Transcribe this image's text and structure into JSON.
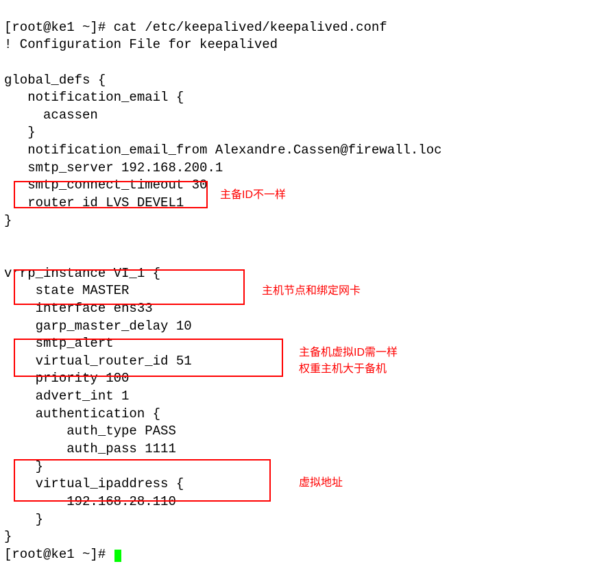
{
  "terminal": {
    "prompt_line": "[root@ke1 ~]# cat /etc/keepalived/keepalived.conf",
    "comment_line": "! Configuration File for keepalived",
    "global_defs_open": "global_defs {",
    "notif_email_open": "   notification_email {",
    "notif_email_value": "     acassen",
    "notif_email_close": "   }",
    "notif_from": "   notification_email_from Alexandre.Cassen@firewall.loc",
    "smtp_server": "   smtp_server 192.168.200.1",
    "smtp_timeout": "   smtp_connect_timeout 30",
    "router_id": "   router_id LVS_DEVEL1",
    "global_close": "}",
    "vrrp_open": "vrrp_instance VI_1 {",
    "state": "    state MASTER",
    "interface": "    interface ens33",
    "garp_delay": "    garp_master_delay 10",
    "smtp_alert": "    smtp_alert",
    "virtual_router_id": "    virtual_router_id 51",
    "priority": "    priority 100",
    "advert_int": "    advert_int 1",
    "auth_open": "    authentication {",
    "auth_type": "        auth_type PASS",
    "auth_pass": "        auth_pass 1111",
    "auth_close": "    }",
    "vip_open": "    virtual_ipaddress {",
    "vip_value": "        192.168.28.110",
    "vip_close": "    }",
    "vrrp_close": "}",
    "prompt_end": "[root@ke1 ~]# "
  },
  "annotations": {
    "a1": "主备ID不一样",
    "a2": "主机节点和绑定网卡",
    "a3_line1": "主备机虚拟ID需一样",
    "a3_line2": "权重主机大于备机",
    "a4": "虚拟地址"
  }
}
